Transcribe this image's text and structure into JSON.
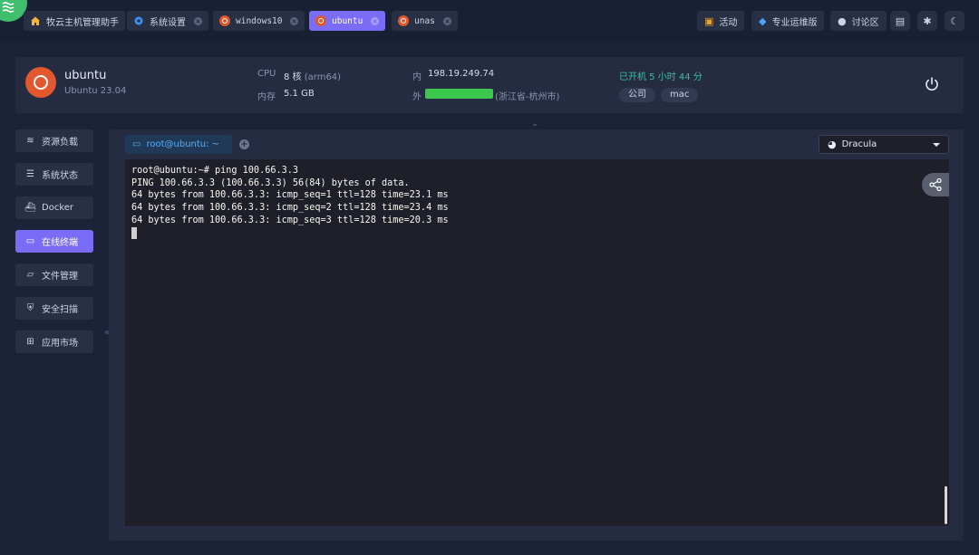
{
  "topbar": {
    "tabs": [
      {
        "label": "牧云主机管理助手",
        "icon": "home-icon",
        "closable": false
      },
      {
        "label": "系统设置",
        "icon": "gear-icon",
        "closable": true
      },
      {
        "label": "windows10",
        "icon": "ubuntu-icon",
        "closable": true
      },
      {
        "label": "ubuntu",
        "icon": "ubuntu-icon",
        "closable": true,
        "active": true
      },
      {
        "label": "unas",
        "icon": "ubuntu-icon",
        "closable": true
      }
    ],
    "right_buttons": [
      {
        "label": "活动",
        "icon": "gift-icon"
      },
      {
        "label": "专业运维版",
        "icon": "diamond-icon"
      },
      {
        "label": "讨论区",
        "icon": "group-icon"
      }
    ],
    "icon_buttons": [
      "document-icon",
      "gear-icon",
      "moon-icon"
    ]
  },
  "host": {
    "name": "ubuntu",
    "os": "Ubuntu 23.04",
    "cpu_label": "CPU",
    "cpu_value": "8 核",
    "cpu_arch": "(arm64)",
    "mem_label": "内存",
    "mem_value": "5.1 GB",
    "inner_label": "内",
    "inner_ip": "198.19.249.74",
    "outer_label": "外",
    "outer_location": "(浙江省-杭州市)",
    "uptime": "已开机 5 小时 44 分",
    "tags": [
      "公司",
      "mac"
    ],
    "power_icon": "power-icon"
  },
  "sidebar": {
    "items": [
      {
        "label": "资源负载",
        "icon": "layers-icon"
      },
      {
        "label": "系统状态",
        "icon": "list-icon"
      },
      {
        "label": "Docker",
        "icon": "docker-icon"
      },
      {
        "label": "在线终端",
        "icon": "terminal-icon",
        "active": true
      },
      {
        "label": "文件管理",
        "icon": "folder-icon"
      },
      {
        "label": "安全扫描",
        "icon": "shield-icon"
      },
      {
        "label": "应用市场",
        "icon": "apps-icon"
      }
    ]
  },
  "terminal": {
    "tab_label": "root@ubuntu: ~",
    "theme": "Dracula",
    "lines": [
      "root@ubuntu:~# ping 100.66.3.3",
      "PING 100.66.3.3 (100.66.3.3) 56(84) bytes of data.",
      "64 bytes from 100.66.3.3: icmp_seq=1 ttl=128 time=23.1 ms",
      "64 bytes from 100.66.3.3: icmp_seq=2 ttl=128 time=23.4 ms",
      "64 bytes from 100.66.3.3: icmp_seq=3 ttl=128 time=20.3 ms"
    ]
  },
  "colors": {
    "accent": "#7b6cf6",
    "uptime": "#36c0a6",
    "ip_bar": "#3cc84d",
    "ubuntu": "#e2572d"
  }
}
